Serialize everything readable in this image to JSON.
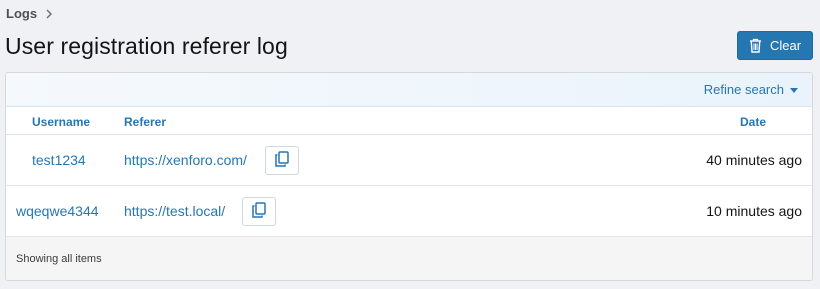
{
  "breadcrumb": {
    "items": [
      {
        "label": "Logs"
      }
    ]
  },
  "page": {
    "title": "User registration referer log"
  },
  "actions": {
    "clear_label": "Clear"
  },
  "filter": {
    "refine_label": "Refine search"
  },
  "table": {
    "columns": {
      "username": "Username",
      "referer": "Referer",
      "date": "Date"
    },
    "rows": [
      {
        "username": "test1234",
        "referer": "https://xenforo.com/",
        "date": "40 minutes ago"
      },
      {
        "username": "wqeqwe4344",
        "referer": "https://test.local/",
        "date": "10 minutes ago"
      }
    ],
    "footer": "Showing all items"
  },
  "colors": {
    "accent": "#2577b1",
    "background": "#eff1f4",
    "text": "#141414"
  },
  "icons": {
    "breadcrumb_separator": "chevron-right-icon",
    "clear": "trash-icon",
    "copy": "copy-icon",
    "refine": "caret-down-icon"
  }
}
